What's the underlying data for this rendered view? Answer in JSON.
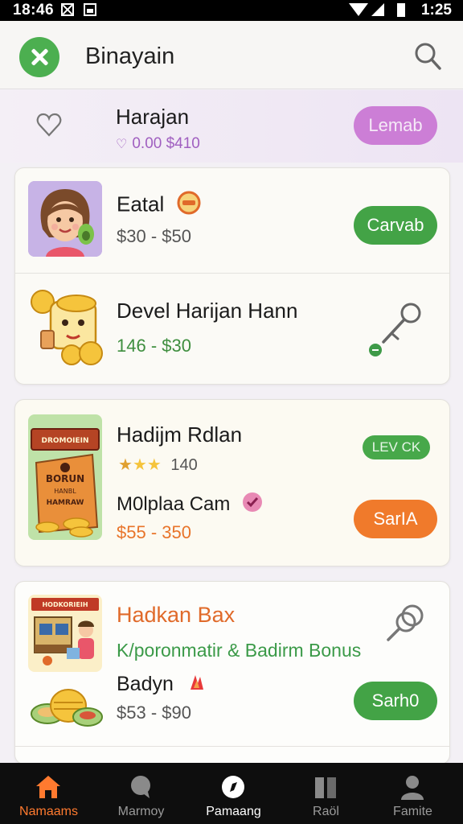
{
  "status_bar": {
    "time": "18:46",
    "clock": "1:25"
  },
  "header": {
    "title": "Binayain",
    "logo_icon": "close-x-icon",
    "search_icon": "search-icon"
  },
  "promo": {
    "name": "Harajan",
    "meta": "0.00 $410",
    "button": "Lemab"
  },
  "items": [
    {
      "name": "Eatal",
      "price": "$30 - $50",
      "button": "Carvab"
    },
    {
      "name": "Devel Harijan Hann",
      "price": "146 - $30"
    }
  ],
  "card2": {
    "name": "Hadijm Rdlan",
    "rating_count": "140",
    "subname": "M0lplaa Cam",
    "price": "$55 - 350",
    "pill": "LEV CK",
    "button": "SarIA",
    "image_text": {
      "banner": "DROMOIEIN",
      "line1": "BORUN",
      "line2": "HANBL",
      "line3": "HAMRAW"
    }
  },
  "card3": {
    "title": "Hadkan Bax",
    "subtitle": "K/poronmatir & Badirm Bonus",
    "name": "Badyn",
    "price": "$53 - $90",
    "button": "Sarh0",
    "image_text": {
      "banner": "HODKORIEIH"
    }
  },
  "nav": [
    {
      "label": "Namaams",
      "icon": "home-icon"
    },
    {
      "label": "Marmoy",
      "icon": "chat-icon"
    },
    {
      "label": "Pamaang",
      "icon": "compass-icon"
    },
    {
      "label": "Raöl",
      "icon": "book-icon"
    },
    {
      "label": "Famite",
      "icon": "profile-icon"
    }
  ],
  "colors": {
    "accent_green": "#43a346",
    "accent_orange": "#f07a2b",
    "accent_purple": "#cc7ed6",
    "nav_active": "#ff7a2f"
  }
}
